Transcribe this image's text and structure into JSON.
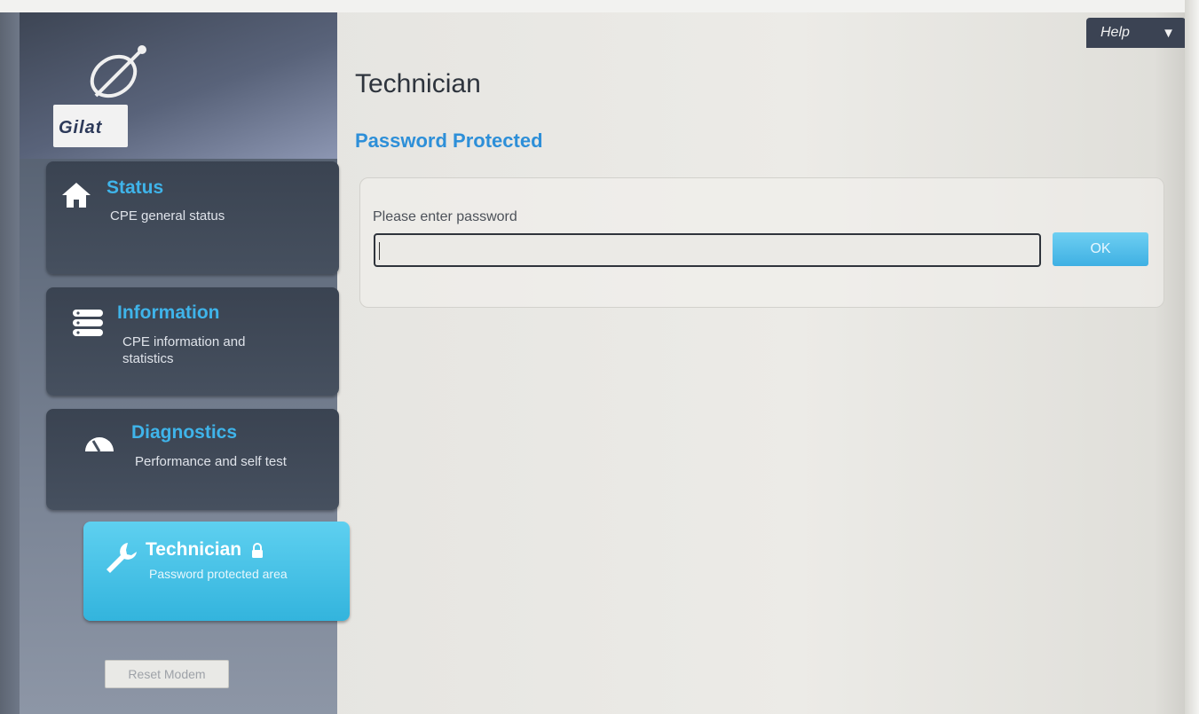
{
  "brand": {
    "logo_text": "Gilat"
  },
  "help": {
    "label": "Help",
    "caret": "▼"
  },
  "sidebar": {
    "items": [
      {
        "key": "status",
        "title": "Status",
        "description": "CPE general status",
        "icon": "home-icon"
      },
      {
        "key": "information",
        "title": "Information",
        "description": "CPE information and statistics",
        "icon": "database-icon"
      },
      {
        "key": "diagnostics",
        "title": "Diagnostics",
        "description": "Performance and self test",
        "icon": "gauge-icon"
      },
      {
        "key": "technician",
        "title": "Technician",
        "description": "Password protected area",
        "icon": "wrench-icon",
        "locked": true,
        "active": true
      }
    ],
    "reset_label": "Reset Modem"
  },
  "main": {
    "title": "Technician",
    "section_title": "Password Protected",
    "password_label": "Please enter password",
    "password_value": "",
    "ok_label": "OK"
  },
  "colors": {
    "accent": "#3fb4ea",
    "active_tab": "#33b4dd",
    "section_title": "#2d8fd8",
    "sidebar_bg": "#4b5563"
  }
}
